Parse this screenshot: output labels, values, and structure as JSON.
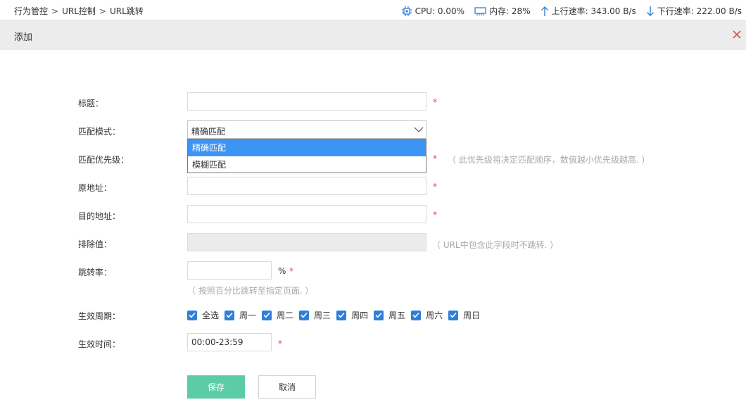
{
  "breadcrumb": [
    "行为管控",
    "URL控制",
    "URL跳转"
  ],
  "breadcrumb_separator": ">",
  "stats": {
    "cpu": "CPU: 0.00%",
    "memory": "内存: 28%",
    "upload": "上行速率: 343.00 B/s",
    "download": "下行速率: 222.00 B/s"
  },
  "dialog": {
    "title": "添加",
    "close_icon": "close-icon"
  },
  "form": {
    "title_label": "标题：",
    "match_mode_label": "匹配模式：",
    "match_mode_value": "精确匹配",
    "match_mode_options": [
      "精确匹配",
      "模糊匹配"
    ],
    "priority_label": "匹配优先级：",
    "priority_hint": "（ 此优先级将决定匹配顺序，数值越小优先级越高. ）",
    "source_label": "原地址：",
    "dest_label": "目的地址：",
    "exclude_label": "排除值：",
    "exclude_hint": "（ URL中包含此字段时不跳转. ）",
    "rate_label": "跳转率：",
    "rate_unit": "%",
    "rate_hint": "（ 按照百分比跳转至指定页面. ）",
    "period_label": "生效周期：",
    "period_days": [
      "全选",
      "周一",
      "周二",
      "周三",
      "周四",
      "周五",
      "周六",
      "周日"
    ],
    "time_label": "生效时间：",
    "time_value": "00:00-23:59",
    "required_mark": "*"
  },
  "buttons": {
    "save": "保存",
    "cancel": "取消"
  },
  "colors": {
    "accent": "#3c94f5",
    "checkbox": "#2f7fd8",
    "save_button": "#5ccca6",
    "required": "#e64545",
    "header_bg": "#ececec",
    "close_icon": "#e05050"
  }
}
